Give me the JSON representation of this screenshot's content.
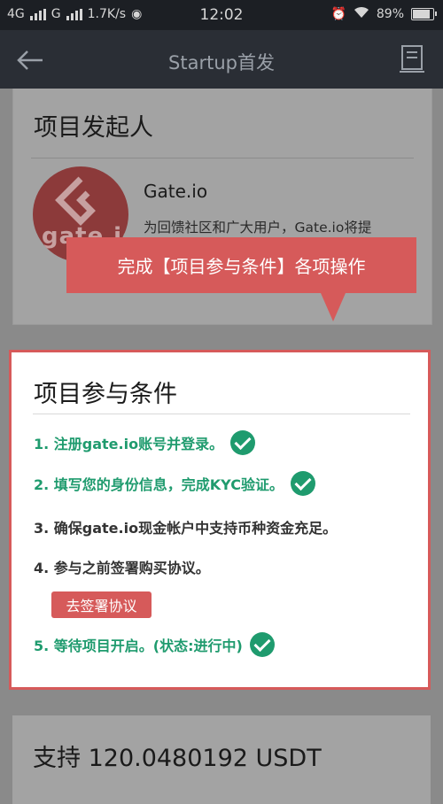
{
  "status_bar": {
    "network1": "4G",
    "network2": "G",
    "speed": "1.7K/s",
    "time": "12:02",
    "battery": "89%",
    "battery_level": 0.89
  },
  "header": {
    "title": "Startup首发",
    "back_icon": "back-arrow-icon",
    "doc_icon": "document-icon"
  },
  "initiator": {
    "heading": "项目发起人",
    "logo_text": "gate.io",
    "name": "Gate.io",
    "description": "为回馈社区和广大用户，Gate.io将提"
  },
  "tooltip": {
    "text": "完成【项目参与条件】各项操作"
  },
  "conditions": {
    "heading": "项目参与条件",
    "steps": [
      {
        "text": "1. 注册gate.io账号并登录。",
        "done": true
      },
      {
        "text": "2. 填写您的身份信息，完成KYC验证。",
        "done": true
      },
      {
        "text": "3. 确保gate.io现金帐户中支持币种资金充足。",
        "done": false
      },
      {
        "text": "4. 参与之前签署购买协议。",
        "done": false
      },
      {
        "text": "5. 等待项目开启。(状态:进行中)",
        "done": true
      }
    ],
    "sign_button": "去签署协议"
  },
  "support": {
    "text": "支持 120.0480192 USDT"
  },
  "colors": {
    "accent_red": "#d65a5a",
    "success_green": "#1f9b6e",
    "header_bg": "#2a2e35"
  }
}
